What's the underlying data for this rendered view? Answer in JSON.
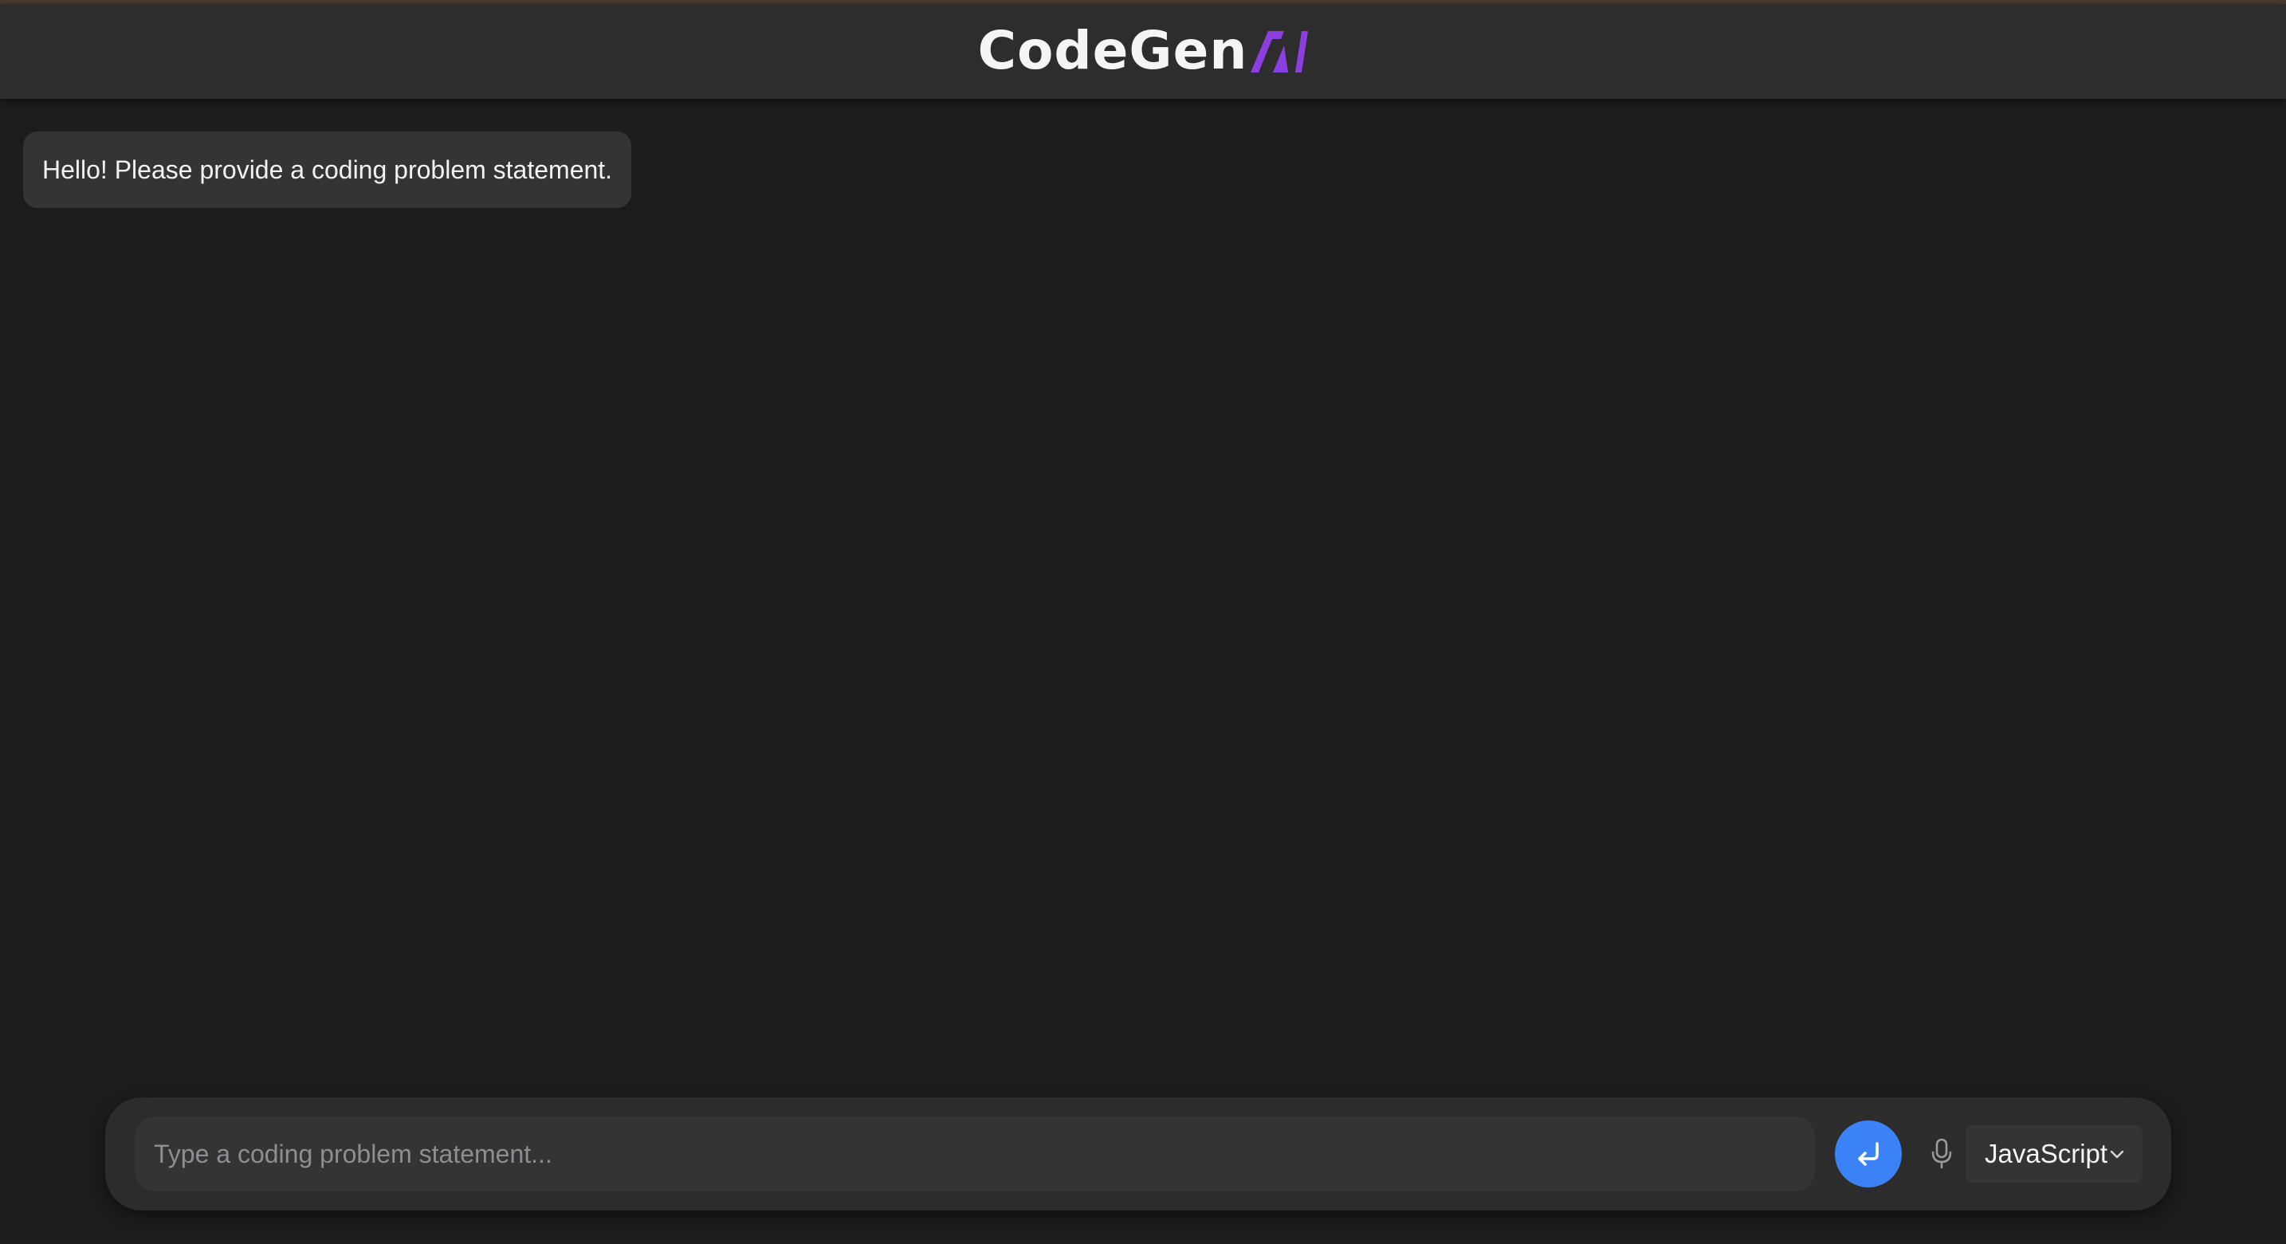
{
  "header": {
    "logo_text": "CodeGen",
    "logo_suffix": "AI",
    "logo_accent_color": "#8b3fe0",
    "accent_strip_color": "#4a3a2e"
  },
  "chat": {
    "messages": [
      {
        "role": "assistant",
        "text": "Hello! Please provide a coding problem statement."
      }
    ]
  },
  "composer": {
    "input_placeholder": "Type a coding problem statement...",
    "input_value": "",
    "send_icon": "enter-return-icon",
    "send_color": "#3b82f6",
    "mic_icon": "microphone-icon",
    "language_selected": "JavaScript",
    "language_icon": "chevron-down-icon"
  }
}
